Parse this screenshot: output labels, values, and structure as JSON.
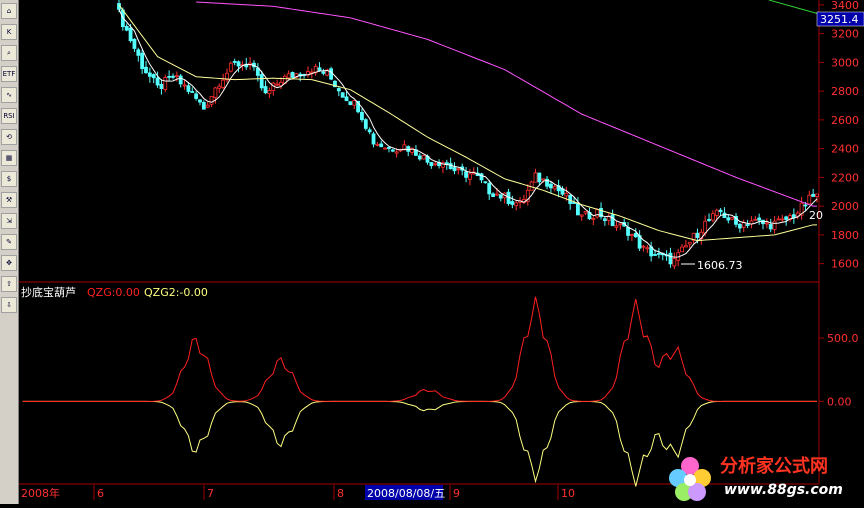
{
  "toolbar": {
    "buttons": [
      {
        "name": "home-icon",
        "glyph": "⌂"
      },
      {
        "name": "kline-icon",
        "glyph": "K"
      },
      {
        "name": "magnifier-icon",
        "glyph": "⌕"
      },
      {
        "name": "etf-icon",
        "glyph": "ETF"
      },
      {
        "name": "wave-icon",
        "glyph": "∿"
      },
      {
        "name": "rsi-icon",
        "glyph": "RSI"
      },
      {
        "name": "refresh-icon",
        "glyph": "⟲"
      },
      {
        "name": "grid-icon",
        "glyph": "▦"
      },
      {
        "name": "dollar-icon",
        "glyph": "$"
      },
      {
        "name": "wrench-icon",
        "glyph": "⚒"
      },
      {
        "name": "import-icon",
        "glyph": "⇲"
      },
      {
        "name": "pencil-icon",
        "glyph": "✎"
      },
      {
        "name": "move-icon",
        "glyph": "✥"
      },
      {
        "name": "arrow-up-icon",
        "glyph": "⇧"
      },
      {
        "name": "arrow-down-icon",
        "glyph": "⇩"
      }
    ]
  },
  "price_panel": {
    "last_price": "3251.4",
    "low_marker": "1606.73",
    "right_edge_label": "20"
  },
  "indicator_panel": {
    "name": "抄底宝葫芦",
    "qzg_label": "QZG:0.00",
    "qzg2_label": "QZG2:-0.00"
  },
  "x_axis": {
    "labels": [
      "2008年",
      "6",
      "7",
      "8",
      "2008/08/08/五",
      "9",
      "10"
    ],
    "cursor_label": "2008/08/08/五"
  },
  "colors": {
    "bg": "#000000",
    "up": "#ff3030",
    "down": "#55ffff",
    "ma_short": "#ffffff",
    "ma_mid": "#ffff99",
    "ma_long": "#ff55ff",
    "ma_longest": "#33cc33",
    "qzg": "#ff2020",
    "qzg2": "#ffff80",
    "axis": "#a00000",
    "cursor_bg": "#0000aa"
  },
  "watermark": {
    "text": "分析家公式网",
    "url": "www.88gs.com"
  },
  "chart_data": {
    "type": "candlestick",
    "price_axis": {
      "ticks": [
        3400,
        3200,
        3000,
        2800,
        2600,
        2400,
        2200,
        2000,
        1800,
        1600
      ],
      "range": [
        1500,
        3420
      ]
    },
    "indicator_axis": {
      "ticks": [
        500.0,
        0.0
      ],
      "labels": [
        "500.0",
        "0.00"
      ],
      "range": [
        -620,
        800
      ]
    },
    "series_close_waypoints": [
      [
        0,
        3340
      ],
      [
        6,
        2980
      ],
      [
        10,
        2820
      ],
      [
        14,
        2900
      ],
      [
        18,
        2810
      ],
      [
        22,
        2680
      ],
      [
        26,
        2870
      ],
      [
        30,
        2990
      ],
      [
        34,
        2990
      ],
      [
        38,
        2770
      ],
      [
        42,
        2880
      ],
      [
        46,
        2920
      ],
      [
        50,
        2960
      ],
      [
        54,
        2920
      ],
      [
        58,
        2780
      ],
      [
        62,
        2690
      ],
      [
        66,
        2450
      ],
      [
        70,
        2400
      ],
      [
        74,
        2420
      ],
      [
        78,
        2360
      ],
      [
        80,
        2310
      ],
      [
        84,
        2310
      ],
      [
        88,
        2230
      ],
      [
        92,
        2220
      ],
      [
        96,
        2110
      ],
      [
        100,
        2060
      ],
      [
        104,
        2010
      ],
      [
        108,
        2200
      ],
      [
        112,
        2160
      ],
      [
        116,
        2060
      ],
      [
        120,
        1920
      ],
      [
        124,
        1960
      ],
      [
        128,
        1880
      ],
      [
        132,
        1830
      ],
      [
        136,
        1700
      ],
      [
        140,
        1650
      ],
      [
        144,
        1620
      ],
      [
        148,
        1750
      ],
      [
        152,
        1880
      ],
      [
        156,
        1960
      ],
      [
        160,
        1870
      ],
      [
        164,
        1900
      ],
      [
        168,
        1870
      ],
      [
        172,
        1890
      ],
      [
        176,
        1960
      ],
      [
        180,
        2070
      ]
    ],
    "ma_waypoints": {
      "ma_mid": [
        [
          0,
          3400
        ],
        [
          10,
          3040
        ],
        [
          20,
          2900
        ],
        [
          30,
          2880
        ],
        [
          40,
          2890
        ],
        [
          50,
          2880
        ],
        [
          60,
          2810
        ],
        [
          70,
          2650
        ],
        [
          80,
          2480
        ],
        [
          90,
          2340
        ],
        [
          100,
          2190
        ],
        [
          110,
          2110
        ],
        [
          120,
          2010
        ],
        [
          130,
          1930
        ],
        [
          140,
          1830
        ],
        [
          150,
          1760
        ],
        [
          160,
          1780
        ],
        [
          170,
          1800
        ],
        [
          180,
          1870
        ]
      ],
      "ma_long": [
        [
          20,
          3420
        ],
        [
          40,
          3390
        ],
        [
          60,
          3310
        ],
        [
          80,
          3160
        ],
        [
          100,
          2950
        ],
        [
          120,
          2640
        ],
        [
          140,
          2420
        ],
        [
          160,
          2200
        ],
        [
          180,
          2000
        ]
      ]
    },
    "qzg_peaks": [
      {
        "center": 20,
        "height": 460
      },
      {
        "center": 42,
        "height": 310
      },
      {
        "center": 80,
        "height": 90
      },
      {
        "center": 108,
        "height": 720
      },
      {
        "center": 134,
        "height": 700
      },
      {
        "center": 144,
        "height": 390
      }
    ],
    "qzg2_troughs": [
      {
        "center": 20,
        "depth": -370
      },
      {
        "center": 42,
        "depth": -320
      },
      {
        "center": 80,
        "depth": -70
      },
      {
        "center": 108,
        "depth": -550
      },
      {
        "center": 134,
        "depth": -580
      },
      {
        "center": 144,
        "depth": -400
      }
    ]
  }
}
